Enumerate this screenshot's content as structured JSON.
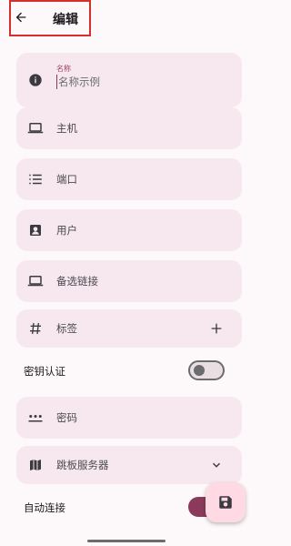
{
  "header": {
    "title": "编辑"
  },
  "fields": {
    "name": {
      "label": "名称",
      "placeholder": "名称示例"
    },
    "host": {
      "label": "主机"
    },
    "port": {
      "label": "端口"
    },
    "user": {
      "label": "用户"
    },
    "alt_links": {
      "label": "备选链接"
    },
    "tags": {
      "label": "标签"
    },
    "key_auth": {
      "label": "密钥认证",
      "enabled": false
    },
    "password": {
      "label": "密码"
    },
    "jump_server": {
      "label": "跳板服务器"
    },
    "auto_connect": {
      "label": "自动连接",
      "enabled": true
    }
  },
  "icons": {
    "back": "arrow-left-icon",
    "name": "info-icon",
    "host": "laptop-icon",
    "port": "list-numbered-icon",
    "user": "account-box-icon",
    "alt_links": "laptop-icon",
    "tags": "hash-icon",
    "add": "plus-icon",
    "password": "password-dots-icon",
    "jump_server": "map-icon",
    "expand": "chevron-down-icon",
    "save": "save-icon"
  },
  "colors": {
    "accent": "#8b3a5b",
    "card_bg": "#f7e8ef",
    "fab_bg": "#ffd9e3",
    "highlight": "#d32f2f"
  }
}
